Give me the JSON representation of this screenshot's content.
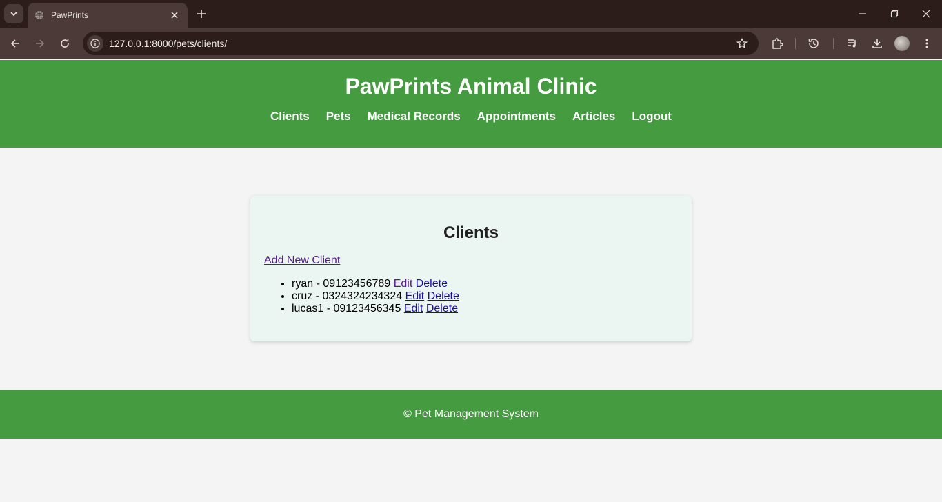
{
  "browser": {
    "tab_title": "PawPrints",
    "url": "127.0.0.1:8000/pets/clients/"
  },
  "header": {
    "title": "PawPrints Animal Clinic",
    "nav": [
      "Clients",
      "Pets",
      "Medical Records",
      "Appointments",
      "Articles",
      "Logout"
    ]
  },
  "main": {
    "heading": "Clients",
    "add_link": "Add New Client",
    "clients": [
      {
        "text": "ryan - 09123456789",
        "edit": "Edit",
        "delete": "Delete"
      },
      {
        "text": "cruz - 0324324234324",
        "edit": "Edit",
        "delete": "Delete"
      },
      {
        "text": "lucas1 - 09123456345",
        "edit": "Edit",
        "delete": "Delete"
      }
    ]
  },
  "footer": {
    "text": "© Pet Management System"
  },
  "colors": {
    "brand_green": "#459b3f",
    "card_bg": "#ebf5f2",
    "visited_link": "#551a8b",
    "link": "#1a0dab"
  }
}
